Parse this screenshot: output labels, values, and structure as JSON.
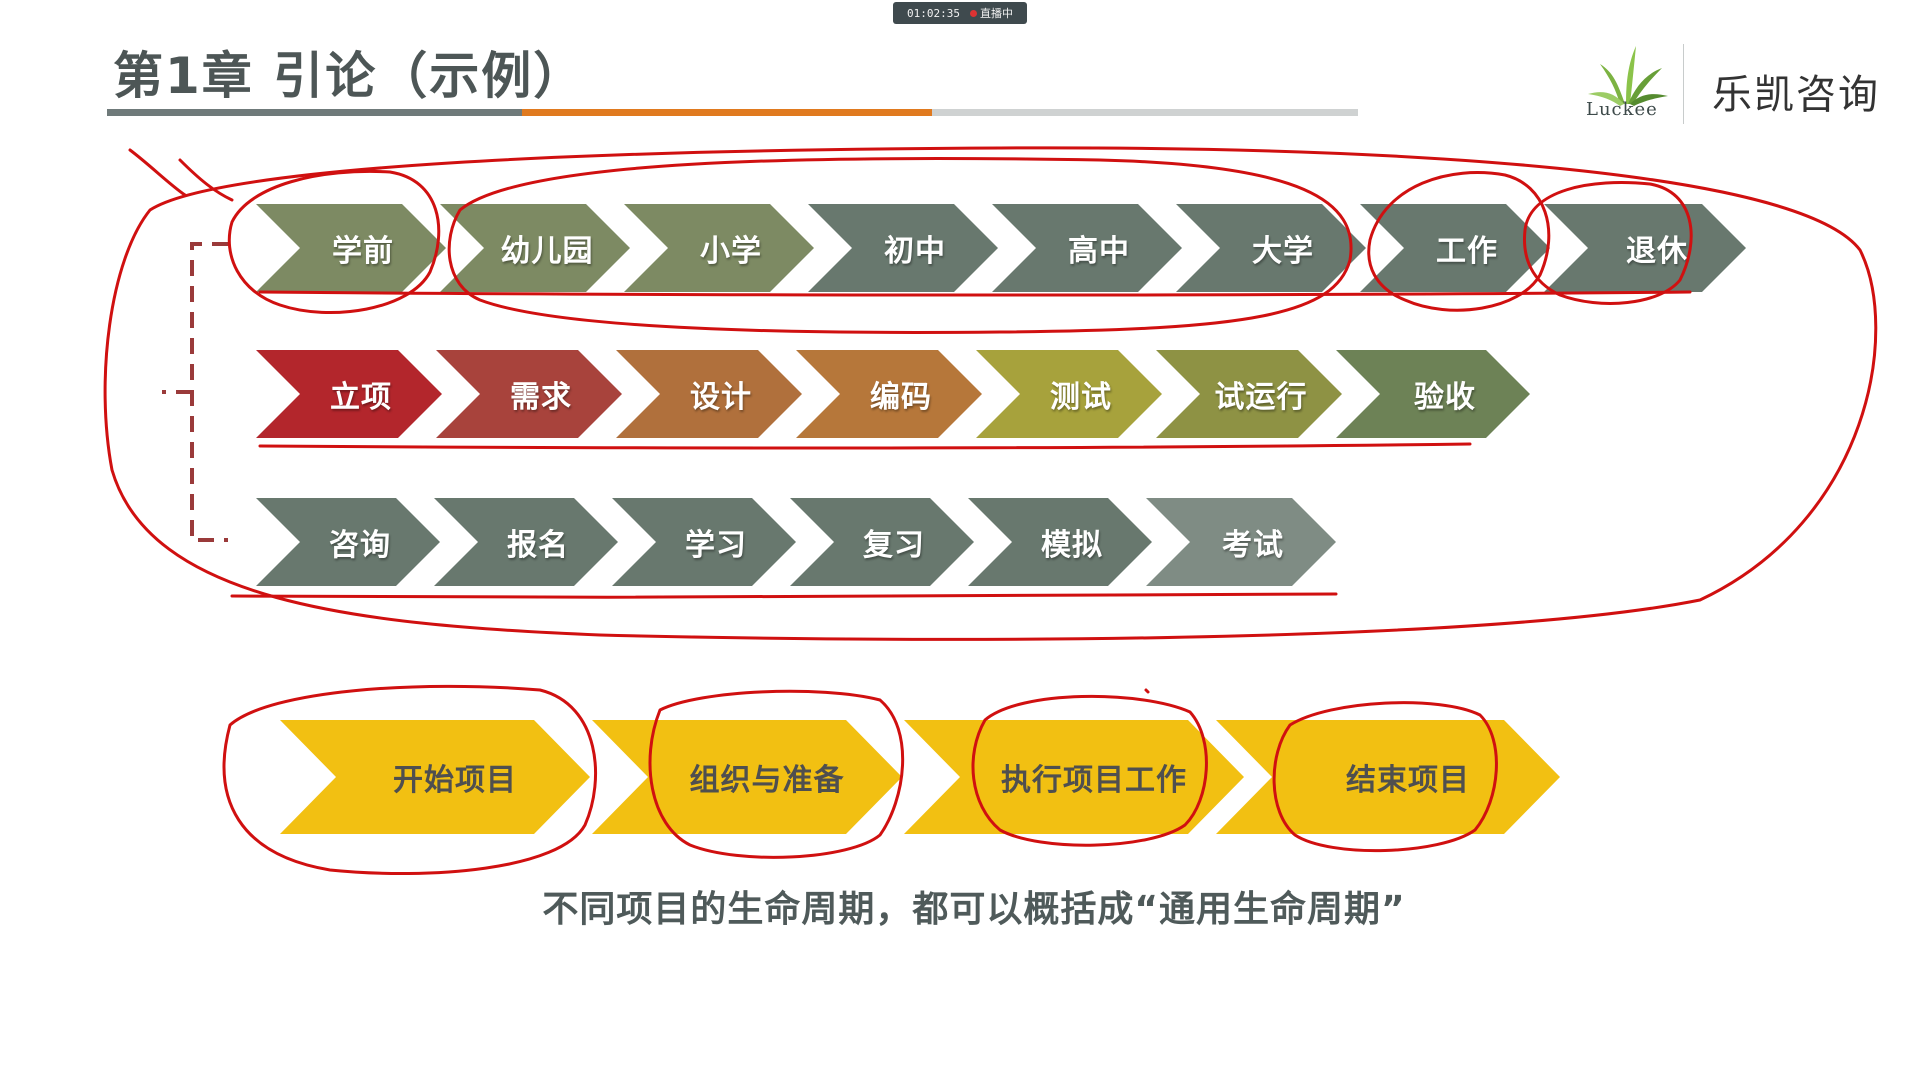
{
  "recording": {
    "time": "01:02:35",
    "status": "直播中"
  },
  "slide": {
    "title": "第1章 引论（示例）",
    "brand": {
      "logo_text": "Luckee",
      "name": "乐凯咨询"
    },
    "row1": [
      {
        "label": "学前",
        "color": "#7d8a63"
      },
      {
        "label": "幼儿园",
        "color": "#7d8a63"
      },
      {
        "label": "小学",
        "color": "#7d8a63"
      },
      {
        "label": "初中",
        "color": "#68786e"
      },
      {
        "label": "高中",
        "color": "#68786e"
      },
      {
        "label": "大学",
        "color": "#68786e"
      },
      {
        "label": "工作",
        "color": "#68786e"
      },
      {
        "label": "退休",
        "color": "#68786e"
      }
    ],
    "row2": [
      {
        "label": "立项",
        "color": "#b3262c"
      },
      {
        "label": "需求",
        "color": "#a8433c"
      },
      {
        "label": "设计",
        "color": "#b0703c"
      },
      {
        "label": "编码",
        "color": "#b6773a"
      },
      {
        "label": "测试",
        "color": "#a7a23c"
      },
      {
        "label": "试运行",
        "color": "#8e9244"
      },
      {
        "label": "验收",
        "color": "#6d8256"
      }
    ],
    "row3": [
      {
        "label": "咨询",
        "color": "#68786e"
      },
      {
        "label": "报名",
        "color": "#68786e"
      },
      {
        "label": "学习",
        "color": "#68786e"
      },
      {
        "label": "复习",
        "color": "#68786e"
      },
      {
        "label": "模拟",
        "color": "#68786e"
      },
      {
        "label": "考试",
        "color": "#7f8c84"
      }
    ],
    "generic": [
      {
        "label": "开始项目"
      },
      {
        "label": "组织与准备"
      },
      {
        "label": "执行项目工作"
      },
      {
        "label": "结束项目"
      }
    ],
    "generic_color": "#f2c012",
    "caption": "不同项目的生命周期，都可以概括成“通用生命周期”"
  },
  "colors": {
    "annotation": "#d01010",
    "bracket": "#9a3a3a"
  }
}
